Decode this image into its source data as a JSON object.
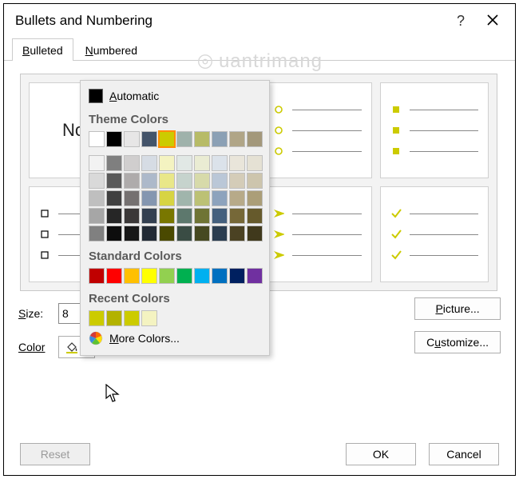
{
  "dialog": {
    "title": "Bullets and Numbering",
    "help": "?",
    "close": "✕"
  },
  "tabs": {
    "bulleted": "Bulleted",
    "numbered": "Numbered"
  },
  "previews": {
    "none": "None"
  },
  "form": {
    "size_label": "Size:",
    "size_value": "8",
    "color_label": "Color"
  },
  "buttons": {
    "picture": "Picture...",
    "customize": "Customize...",
    "reset": "Reset",
    "ok": "OK",
    "cancel": "Cancel"
  },
  "color_picker": {
    "automatic": "Automatic",
    "theme_head": "Theme Colors",
    "standard_head": "Standard Colors",
    "recent_head": "Recent Colors",
    "more": "More Colors...",
    "theme_base": [
      "#ffffff",
      "#000000",
      "#e7e6e6",
      "#44546a",
      "#cccb00",
      "#9fb2ab",
      "#b7bb67",
      "#8ba0b5",
      "#b0a587",
      "#a3987b"
    ],
    "theme_shades": [
      [
        "#f2f2f2",
        "#7f7f7f",
        "#d0cece",
        "#d6dce4",
        "#f4f3c1",
        "#e1e8e5",
        "#eaecd3",
        "#dbe2ea",
        "#e9e5da",
        "#e5e1d4"
      ],
      [
        "#d9d9d9",
        "#595959",
        "#aeabab",
        "#adb9ca",
        "#e9e789",
        "#c6d3cd",
        "#d7daaa",
        "#bac7d7",
        "#d4ccb8",
        "#cdc5ad"
      ],
      [
        "#bfbfbf",
        "#404040",
        "#757171",
        "#8496b0",
        "#d7d443",
        "#a0b5ac",
        "#bcc175",
        "#8da3bd",
        "#b7aa89",
        "#ab9e78"
      ],
      [
        "#a6a6a6",
        "#262626",
        "#3b3838",
        "#333f50",
        "#797700",
        "#5d786d",
        "#6f7435",
        "#44607e",
        "#766838",
        "#665a2c"
      ],
      [
        "#808080",
        "#0d0d0d",
        "#171717",
        "#222a35",
        "#4a4900",
        "#3a4c44",
        "#464921",
        "#2b3d50",
        "#4b4223",
        "#40391c"
      ]
    ],
    "standard": [
      "#c00000",
      "#ff0000",
      "#ffc000",
      "#ffff00",
      "#92d050",
      "#00b050",
      "#00b0f0",
      "#0070c0",
      "#002060",
      "#7030a0"
    ],
    "recent": [
      "#cccb00",
      "#b3b200",
      "#cccb00",
      "#f4f3c1"
    ]
  },
  "accent": "#cccb00",
  "watermark": "uantrimang"
}
